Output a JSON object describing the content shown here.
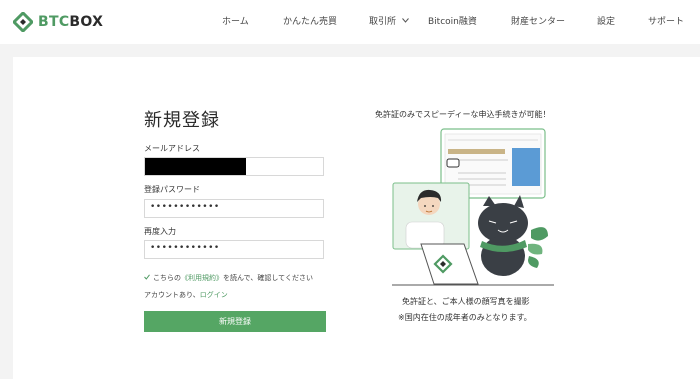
{
  "brand": {
    "name_part1": "BTC",
    "name_part2": "BOX",
    "accent": "#4f9a63"
  },
  "nav": {
    "items": [
      {
        "label": "ホーム"
      },
      {
        "label": "かんたん売買"
      },
      {
        "label": "取引所",
        "icon": "chevron-down-icon"
      },
      {
        "label": "Bitcoin融資"
      },
      {
        "label": "財産センター"
      },
      {
        "label": "設定"
      },
      {
        "label": "サポート"
      }
    ]
  },
  "form": {
    "title": "新規登録",
    "email_label": "メールアドレス",
    "password_label": "登録パスワード",
    "password_value": "••••••••••••",
    "confirm_label": "再度入力",
    "confirm_value": "••••••••••••",
    "agree_prefix": "こちらの",
    "agree_link": "《利用規約》",
    "agree_suffix": "を読んで、確認してください",
    "account_prefix": "アカウントあり、",
    "login_link": "ログイン",
    "submit_label": "新規登録",
    "button_color": "#55a664"
  },
  "promo": {
    "headline": "免許証のみでスピーディーな申込手続きが可能！",
    "caption_line1": "免許証と、ご本人様の顔写真を撮影",
    "caption_line2": "※国内在住の成年者のみとなります。"
  }
}
